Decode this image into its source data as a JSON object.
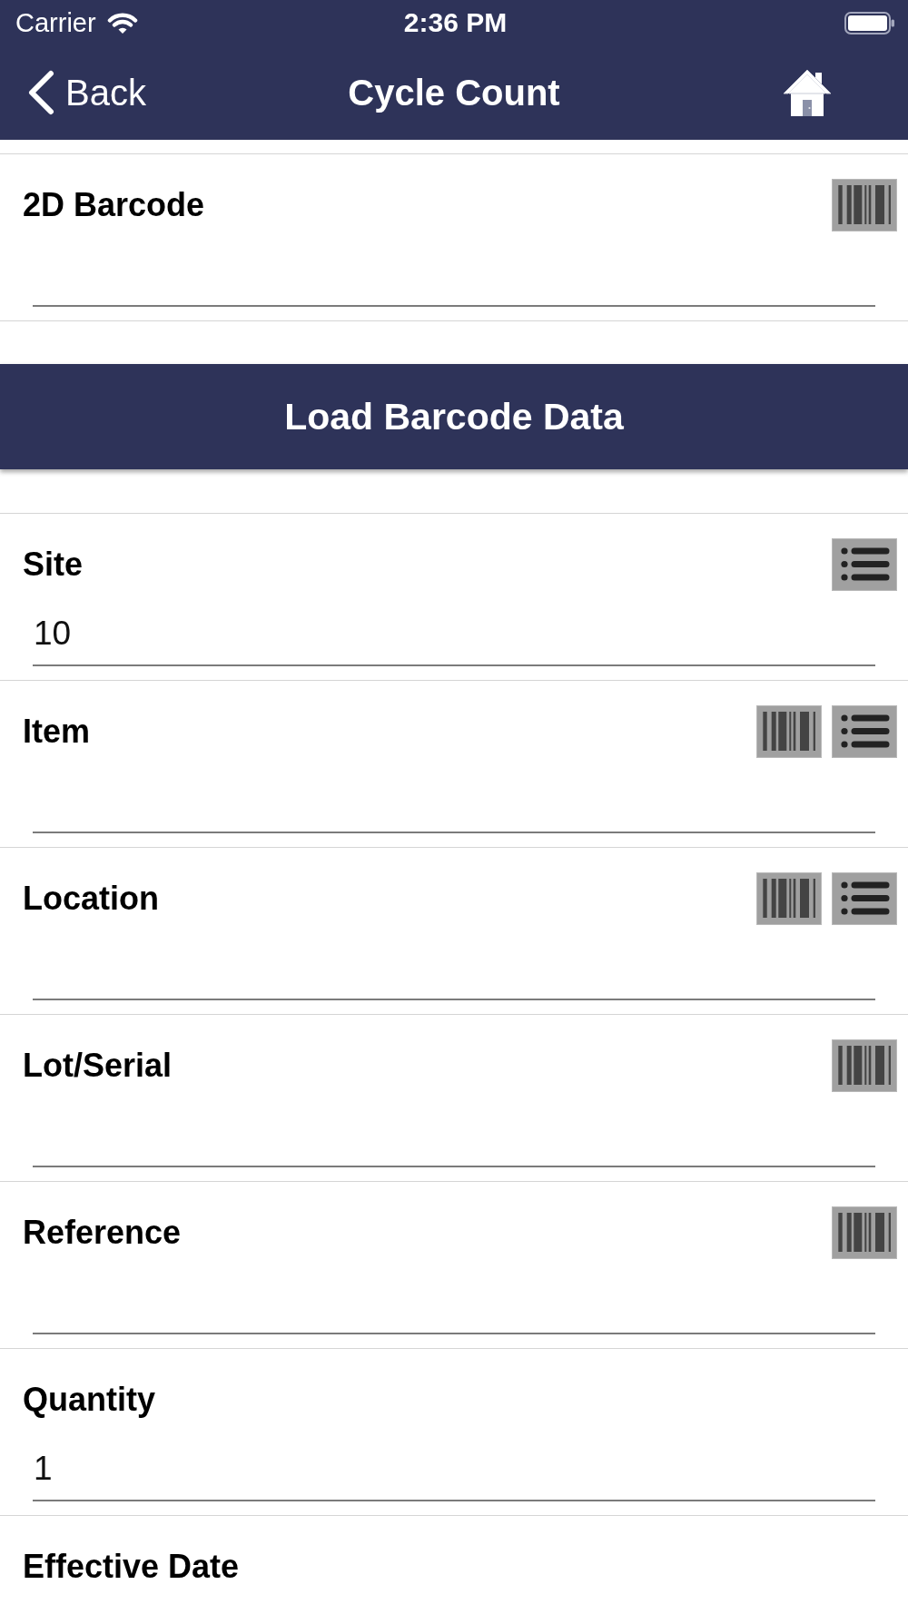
{
  "status_bar": {
    "carrier": "Carrier",
    "time": "2:36 PM"
  },
  "nav_bar": {
    "back": "Back",
    "title": "Cycle Count"
  },
  "form": [
    {
      "kind": "field",
      "label": "2D Barcode",
      "buttons": [
        {
          "kind": "scan"
        }
      ]
    },
    {
      "kind": "button",
      "label": "Load Barcode Data"
    },
    {
      "kind": "field",
      "label": "Site",
      "value": "10",
      "buttons": [
        {
          "kind": "list"
        }
      ]
    },
    {
      "kind": "field",
      "label": "Item",
      "buttons": [
        {
          "kind": "scan"
        },
        {
          "kind": "list"
        }
      ]
    },
    {
      "kind": "field",
      "label": "Location",
      "buttons": [
        {
          "kind": "scan"
        },
        {
          "kind": "list"
        }
      ]
    },
    {
      "kind": "field",
      "label": "Lot/Serial",
      "buttons": [
        {
          "kind": "scan"
        }
      ]
    },
    {
      "kind": "field",
      "label": "Reference",
      "buttons": [
        {
          "kind": "scan"
        }
      ]
    },
    {
      "kind": "field",
      "label": "Quantity",
      "value": "1"
    },
    {
      "kind": "label",
      "label": "Effective Date"
    }
  ]
}
